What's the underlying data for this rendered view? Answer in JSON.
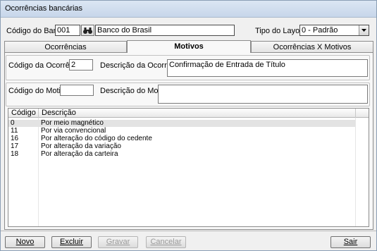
{
  "window": {
    "title": "Ocorrências bancárias"
  },
  "header": {
    "bank_code_label": "Código do Banco:",
    "bank_code_value": "001",
    "bank_name_value": "Banco do Brasil",
    "layout_label": "Tipo do Layout:",
    "layout_value": "0 - Padrão"
  },
  "tabs": [
    {
      "label": "Ocorrências",
      "active": false
    },
    {
      "label": "Motivos",
      "active": true
    },
    {
      "label": "Ocorrências X Motivos",
      "active": false
    }
  ],
  "occurrence": {
    "code_label": "Código da Ocorrência:",
    "code_value": "2",
    "desc_label": "Descrição da Ocorrência:",
    "desc_value": "Confirmação de Entrada de Título"
  },
  "reason": {
    "code_label": "Código do Motivo:",
    "code_value": "",
    "desc_label": "Descrição do Motivo:",
    "desc_value": ""
  },
  "grid": {
    "columns": [
      "Código",
      "Descrição"
    ],
    "rows": [
      {
        "code": "0",
        "desc": "Por meio magnético"
      },
      {
        "code": "11",
        "desc": "Por via convencional"
      },
      {
        "code": "16",
        "desc": "Por alteração do código do cedente"
      },
      {
        "code": "17",
        "desc": "Por alteração da variação"
      },
      {
        "code": "18",
        "desc": "Por alteração da carteira"
      }
    ]
  },
  "buttons": {
    "new": "Novo",
    "delete": "Excluir",
    "save": "Gravar",
    "cancel": "Cancelar",
    "exit": "Sair"
  }
}
